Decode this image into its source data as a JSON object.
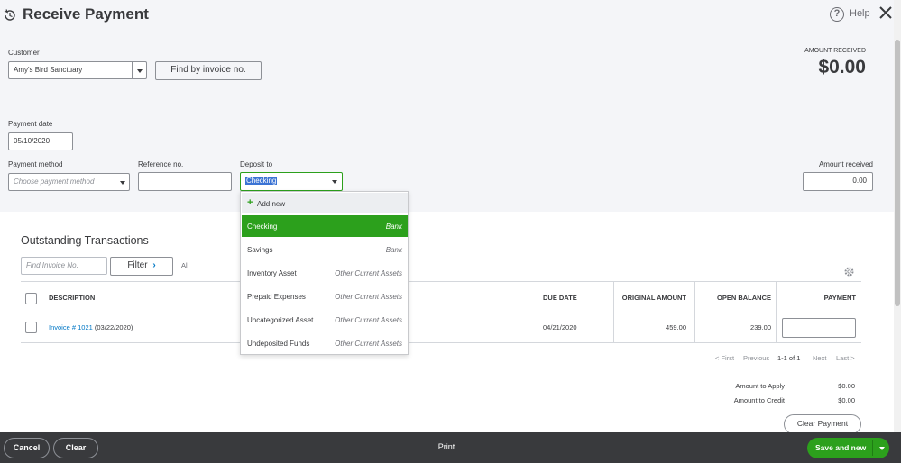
{
  "header": {
    "title": "Receive Payment",
    "help_label": "Help"
  },
  "customer": {
    "label": "Customer",
    "value": "Amy's Bird Sanctuary",
    "find_button": "Find by invoice no."
  },
  "amount_received_header": {
    "label": "AMOUNT RECEIVED",
    "value": "$0.00"
  },
  "payment_date": {
    "label": "Payment date",
    "value": "05/10/2020"
  },
  "payment_method": {
    "label": "Payment method",
    "placeholder": "Choose payment method"
  },
  "reference": {
    "label": "Reference no.",
    "value": ""
  },
  "deposit_to": {
    "label": "Deposit to",
    "value": "Checking"
  },
  "amount_received_field": {
    "label": "Amount received",
    "value": "0.00"
  },
  "dropdown": {
    "add_new": "Add new",
    "items": [
      {
        "name": "Checking",
        "type": "Bank",
        "selected": true
      },
      {
        "name": "Savings",
        "type": "Bank"
      },
      {
        "name": "Inventory Asset",
        "type": "Other Current Assets"
      },
      {
        "name": "Prepaid Expenses",
        "type": "Other Current Assets"
      },
      {
        "name": "Uncategorized Asset",
        "type": "Other Current Assets"
      },
      {
        "name": "Undeposited Funds",
        "type": "Other Current Assets"
      }
    ]
  },
  "outstanding": {
    "title": "Outstanding Transactions",
    "find_placeholder": "Find Invoice No.",
    "filter_label": "Filter",
    "all_label": "All",
    "columns": {
      "description": "DESCRIPTION",
      "due_date": "DUE DATE",
      "original_amount": "ORIGINAL AMOUNT",
      "open_balance": "OPEN BALANCE",
      "payment": "PAYMENT"
    },
    "rows": [
      {
        "invoice_link": "Invoice # 1021",
        "invoice_date": "(03/22/2020)",
        "due_date": "04/21/2020",
        "original_amount": "459.00",
        "open_balance": "239.00",
        "payment": ""
      }
    ],
    "pager": {
      "first": "< First",
      "previous": "Previous",
      "range": "1-1 of 1",
      "next": "Next",
      "last": "Last >"
    },
    "totals": {
      "apply_label": "Amount to Apply",
      "apply_value": "$0.00",
      "credit_label": "Amount to Credit",
      "credit_value": "$0.00"
    },
    "clear_payment": "Clear Payment"
  },
  "footer": {
    "cancel": "Cancel",
    "clear": "Clear",
    "print": "Print",
    "save": "Save and new"
  }
}
